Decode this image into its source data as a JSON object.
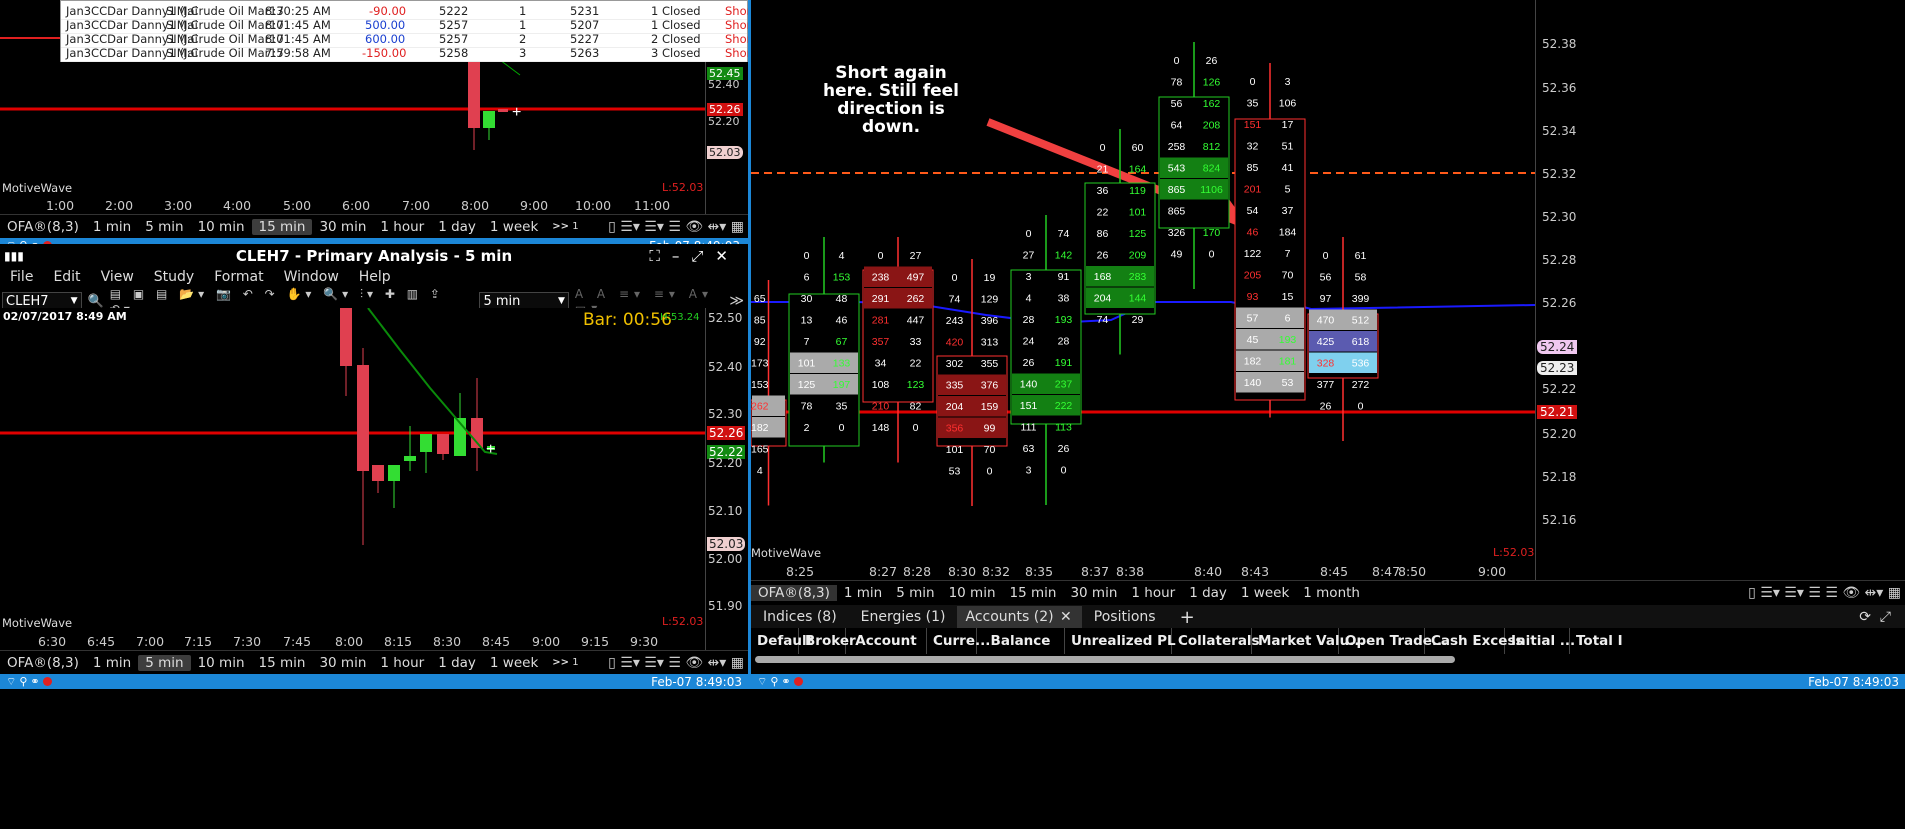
{
  "orders_table": {
    "rows": [
      {
        "account": "Jan3CCDar Danny1 (Jai",
        "instrument": "SIM:Crude Oil Mar17",
        "time": "8:30:25 AM",
        "pl": "-90.00",
        "pl_color": "#e02020",
        "price": "5222",
        "qty": "1",
        "exit": "5231",
        "status": "1 Closed",
        "side": "Short"
      },
      {
        "account": "Jan3CCDar Danny1 (Jai",
        "instrument": "SIM:Crude Oil Mar17",
        "time": "8:01:45 AM",
        "pl": "500.00",
        "pl_color": "#1a3fcf",
        "price": "5257",
        "qty": "1",
        "exit": "5207",
        "status": "1 Closed",
        "side": "Short"
      },
      {
        "account": "Jan3CCDar Danny1 (Jai",
        "instrument": "SIM:Crude Oil Mar17",
        "time": "8:01:45 AM",
        "pl": "600.00",
        "pl_color": "#1a3fcf",
        "price": "5257",
        "qty": "2",
        "exit": "5227",
        "status": "2 Closed",
        "side": "Short"
      },
      {
        "account": "Jan3CCDar Danny1 (Jai",
        "instrument": "SIM:Crude Oil Mar17",
        "time": "7:59:58 AM",
        "pl": "-150.00",
        "pl_color": "#e02020",
        "price": "5258",
        "qty": "3",
        "exit": "5263",
        "status": "3 Closed",
        "side": "Short"
      }
    ]
  },
  "top_left_chart": {
    "watermark": "MotiveWave",
    "last_label": "L:52.03",
    "price_labels": [
      "52.45",
      "52.40",
      "52.26",
      "52.20",
      "52.03"
    ],
    "time_labels": [
      "1:00",
      "2:00",
      "3:00",
      "4:00",
      "5:00",
      "6:00",
      "7:00",
      "8:00",
      "9:00",
      "10:00",
      "11:00"
    ]
  },
  "top_left_timeframes": {
    "study": "OFA®(8,3)",
    "items": [
      "1 min",
      "5 min",
      "10 min",
      "15 min",
      "30 min",
      "1 hour",
      "1 day",
      "1 week"
    ],
    "active": "15 min",
    "more": ">>",
    "more_count": "1"
  },
  "status_bar": {
    "timestamp": "Feb-07 8:49:03"
  },
  "mid_window": {
    "title": "CLEH7 - Primary Analysis - 5 min",
    "menu": [
      "File",
      "Edit",
      "View",
      "Study",
      "Format",
      "Window",
      "Help"
    ],
    "symbol": "CLEH7",
    "period": "5 min"
  },
  "mid_chart": {
    "date_label": "02/07/2017 8:49 AM",
    "bar_timer": "Bar: 00:56",
    "high_label": "H:53.24",
    "watermark": "MotiveWave",
    "last_label": "L:52.03",
    "price_labels": [
      "52.50",
      "52.40",
      "52.30",
      "52.26",
      "52.22",
      "52.20",
      "52.10",
      "52.03",
      "52.00",
      "51.90"
    ],
    "time_labels": [
      "6:30",
      "6:45",
      "7:00",
      "7:15",
      "7:30",
      "7:45",
      "8:00",
      "8:15",
      "8:30",
      "8:45",
      "9:00",
      "9:15",
      "9:30"
    ]
  },
  "bottom_left_timeframes": {
    "study": "OFA®(8,3)",
    "items": [
      "1 min",
      "5 min",
      "10 min",
      "15 min",
      "30 min",
      "1 hour",
      "1 day",
      "1 week"
    ],
    "active": "5 min",
    "more": ">>",
    "more_count": "1"
  },
  "right_chart": {
    "annotation_lines": [
      "Short again",
      "here. Still feel",
      "direction is",
      "down."
    ],
    "watermark": "MotiveWave",
    "last_label": "L:52.03",
    "price_labels": [
      "52.38",
      "52.36",
      "52.34",
      "52.32",
      "52.30",
      "52.28",
      "52.26",
      "52.24",
      "52.23",
      "52.22",
      "52.21",
      "52.20",
      "52.18",
      "52.16"
    ],
    "time_labels": [
      "8:25",
      "8:27",
      "8:28",
      "8:30",
      "8:32",
      "8:35",
      "8:37",
      "8:38",
      "8:40",
      "8:43",
      "8:45",
      "8:47",
      "8:50",
      "9:00"
    ],
    "footprint": {
      "c1": [
        [
          "65",
          ""
        ],
        [
          "85",
          ""
        ],
        [
          "92",
          ""
        ],
        [
          "173",
          ""
        ],
        [
          "153",
          ""
        ],
        [
          "262",
          ""
        ],
        [
          "182",
          ""
        ],
        [
          "165",
          ""
        ],
        [
          "4",
          ""
        ]
      ],
      "c2": [
        [
          "0",
          "4"
        ],
        [
          "6",
          "153"
        ],
        [
          "30",
          "48"
        ],
        [
          "13",
          "46"
        ],
        [
          "7",
          "67"
        ],
        [
          "101",
          "133"
        ],
        [
          "125",
          "197"
        ],
        [
          "78",
          "35"
        ],
        [
          "2",
          "0"
        ]
      ],
      "c3": [
        [
          "0",
          "27"
        ],
        [
          "238",
          "497"
        ],
        [
          "291",
          "262"
        ],
        [
          "281",
          "447"
        ],
        [
          "357",
          "33"
        ],
        [
          "34",
          "22"
        ],
        [
          "108",
          "123"
        ],
        [
          "210",
          "82"
        ],
        [
          "148",
          "0"
        ]
      ],
      "c4": [
        [
          "0",
          "19"
        ],
        [
          "74",
          "129"
        ],
        [
          "243",
          "396"
        ],
        [
          "420",
          "313"
        ],
        [
          "302",
          "355"
        ],
        [
          "335",
          "376"
        ],
        [
          "204",
          "159"
        ],
        [
          "356",
          "99"
        ],
        [
          "101",
          "70"
        ],
        [
          "53",
          "0"
        ]
      ],
      "c5": [
        [
          "0",
          "74"
        ],
        [
          "27",
          "142"
        ],
        [
          "3",
          "91"
        ],
        [
          "4",
          "38"
        ],
        [
          "28",
          "193"
        ],
        [
          "24",
          "28"
        ],
        [
          "26",
          "191"
        ],
        [
          "140",
          "237"
        ],
        [
          "151",
          "222"
        ],
        [
          "111",
          "113"
        ],
        [
          "63",
          "26"
        ],
        [
          "3",
          "0"
        ]
      ],
      "c6": [
        [
          "0",
          "60"
        ],
        [
          "21",
          "164"
        ],
        [
          "36",
          "119"
        ],
        [
          "22",
          "101"
        ],
        [
          "86",
          "125"
        ],
        [
          "26",
          "209"
        ],
        [
          "168",
          "283"
        ],
        [
          "204",
          "144"
        ],
        [
          "74",
          "29"
        ]
      ],
      "c7": [
        [
          "0",
          "26"
        ],
        [
          "78",
          "126"
        ],
        [
          "56",
          "162"
        ],
        [
          "64",
          "208"
        ],
        [
          "258",
          "812"
        ],
        [
          "543",
          "824"
        ],
        [
          "865",
          "1106"
        ],
        [
          "865",
          ""
        ],
        [
          "326",
          "170"
        ],
        [
          "49",
          "0"
        ]
      ],
      "c8": [
        [
          "0",
          "3"
        ],
        [
          "35",
          "106"
        ],
        [
          "151",
          "17"
        ],
        [
          "32",
          "51"
        ],
        [
          "85",
          "41"
        ],
        [
          "201",
          "5"
        ],
        [
          "54",
          "37"
        ],
        [
          "46",
          "184"
        ],
        [
          "122",
          "7"
        ],
        [
          "205",
          "70"
        ],
        [
          "93",
          "15"
        ],
        [
          "57",
          "6"
        ],
        [
          "45",
          "193"
        ],
        [
          "182",
          "181"
        ],
        [
          "140",
          "53"
        ]
      ],
      "c9": [
        [
          "0",
          "61"
        ],
        [
          "56",
          "58"
        ],
        [
          "97",
          "399"
        ],
        [
          "470",
          "512"
        ],
        [
          "425",
          "618"
        ],
        [
          "328",
          "536"
        ],
        [
          "377",
          "272"
        ],
        [
          "26",
          "0"
        ]
      ]
    }
  },
  "right_timeframes": {
    "study": "OFA®(8,3)",
    "items": [
      "1 min",
      "5 min",
      "10 min",
      "15 min",
      "30 min",
      "1 hour",
      "1 day",
      "1 week",
      "1 month"
    ]
  },
  "bottom_tabs": {
    "items": [
      "Indices (8)",
      "Energies (1)",
      "Accounts (2)",
      "Positions"
    ],
    "active": "Accounts (2)",
    "add": "+"
  },
  "accounts_grid": {
    "headers": [
      "Default",
      "Broker",
      "Account",
      "Curre...",
      "Balance",
      "Unrealized PL",
      "Collaterals",
      "Market Valu...",
      "Open Trade...",
      "Cash Excess",
      "Initial ...",
      "Total I"
    ]
  },
  "colors": {
    "accent": "#1c87d7",
    "bull": "#22dd22",
    "bear": "#e02020",
    "ema": "#1a1aff",
    "hline": "#e00000"
  }
}
